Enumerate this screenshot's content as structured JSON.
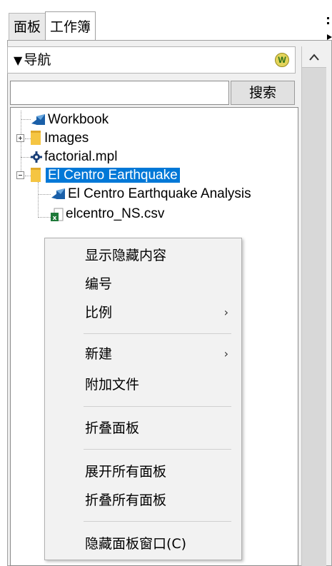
{
  "tabs": [
    {
      "label": "面板"
    },
    {
      "label": "工作簿"
    }
  ],
  "navigator": {
    "header_label": "导航",
    "header_icon": "w-badge-icon"
  },
  "search": {
    "value": "",
    "button_label": "搜索"
  },
  "tree": {
    "items": [
      {
        "label": "Workbook",
        "icon": "mathcad-workbook-icon",
        "level": 0,
        "expander": "none",
        "selected": false
      },
      {
        "label": "Images",
        "icon": "folder-icon",
        "level": 0,
        "expander": "collapsed",
        "selected": false
      },
      {
        "label": "factorial.mpl",
        "icon": "gear-icon",
        "level": 0,
        "expander": "none",
        "selected": false
      },
      {
        "label": "El Centro Earthquake",
        "icon": "folder-icon",
        "level": 0,
        "expander": "expanded",
        "selected": true
      },
      {
        "label": "El Centro Earthquake Analysis",
        "icon": "mathcad-workbook-icon",
        "level": 1,
        "expander": "none",
        "selected": false
      },
      {
        "label": "elcentro_NS.csv",
        "icon": "excel-file-icon",
        "level": 1,
        "expander": "none",
        "selected": false
      }
    ]
  },
  "context_menu": {
    "items": [
      {
        "label": "显示隐藏内容",
        "submenu": false
      },
      {
        "label": "编号",
        "submenu": false
      },
      {
        "label": "比例",
        "submenu": true
      },
      {
        "label": "新建",
        "submenu": true
      },
      {
        "label": "附加文件",
        "submenu": false
      },
      {
        "label": "折叠面板",
        "submenu": false
      },
      {
        "label": "展开所有面板",
        "submenu": false
      },
      {
        "label": "折叠所有面板",
        "submenu": false
      },
      {
        "label": "隐藏面板窗口(C)",
        "submenu": false
      }
    ],
    "submenu_arrow": "›"
  },
  "colors": {
    "selection": "#0078d7",
    "folder": "#f5c542",
    "workbook_icon": "#1a5fa8",
    "menu_background": "#f2f2f2"
  }
}
